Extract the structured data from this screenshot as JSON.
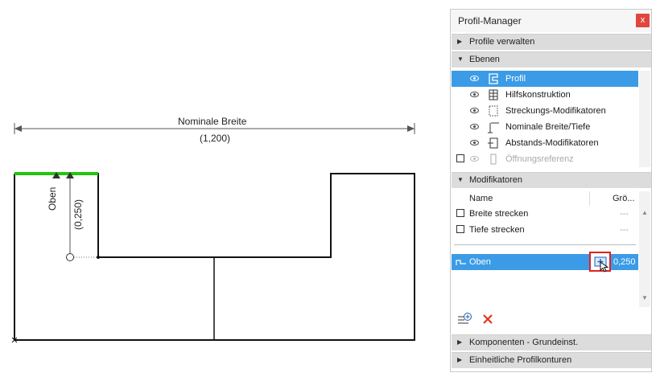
{
  "drawing": {
    "dimension_label": "Nominale Breite",
    "dimension_value": "(1,200)",
    "offset_label": "Oben",
    "offset_value": "(0,250)"
  },
  "panel": {
    "title": "Profil-Manager",
    "close_symbol": "x",
    "sections": {
      "profile_verwalten": "Profile verwalten",
      "ebenen": "Ebenen",
      "modifikatoren": "Modifikatoren",
      "komponenten": "Komponenten - Grundeinst.",
      "einheitliche": "Einheitliche Profilkonturen"
    },
    "layers": [
      {
        "label": "Profil",
        "icon": "profile-shape-icon",
        "selected": true
      },
      {
        "label": "Hilfskonstruktion",
        "icon": "grid-construction-icon",
        "selected": false
      },
      {
        "label": "Streckungs-Modifikatoren",
        "icon": "stretch-modifier-icon",
        "selected": false
      },
      {
        "label": "Nominale Breite/Tiefe",
        "icon": "nominal-dimension-icon",
        "selected": false
      },
      {
        "label": "Abstands-Modifikatoren",
        "icon": "offset-modifier-icon",
        "selected": false
      },
      {
        "label": "Öffnungsreferenz",
        "icon": "opening-reference-icon",
        "selected": false
      }
    ],
    "modifier_columns": {
      "name": "Name",
      "size": "Grö..."
    },
    "modifiers": [
      {
        "label": "Breite strecken",
        "value": "---"
      },
      {
        "label": "Tiefe strecken",
        "value": "---"
      }
    ],
    "offset_modifier": {
      "label": "Oben",
      "value": "0,250"
    }
  },
  "colors": {
    "selection": "#3b9be6",
    "close": "#e0463e",
    "highlight_edge": "#22c40f",
    "delete": "#e8321d"
  }
}
